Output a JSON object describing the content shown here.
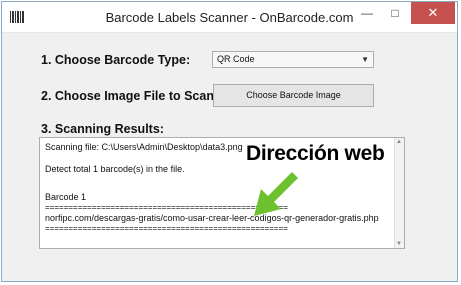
{
  "window": {
    "title": "Barcode Labels Scanner - OnBarcode.com",
    "minimize_glyph": "—",
    "maximize_glyph": "□",
    "close_glyph": "✕"
  },
  "step1": {
    "label": "1. Choose Barcode Type:",
    "selected_type": "QR Code"
  },
  "step2": {
    "label": "2. Choose Image File to Scan:",
    "button_label": "Choose Barcode Image"
  },
  "step3": {
    "label": "3. Scanning Results:",
    "lines": [
      "Scanning file: C:\\Users\\Admin\\Desktop\\data3.png",
      "",
      "Detect total 1 barcode(s) in the file.",
      "",
      "",
      "Barcode 1",
      "====================================================",
      "norfipc.com/descargas-gratis/como-usar-crear-leer-codigos-qr-generador-gratis.php",
      "===================================================="
    ]
  },
  "annotation": {
    "text": "Dirección web",
    "arrow_color": "#6bc22e"
  },
  "icons": [
    "barcode-app-icon",
    "chevron-down-icon",
    "minimize-icon",
    "maximize-icon",
    "close-icon",
    "green-arrow-icon"
  ]
}
